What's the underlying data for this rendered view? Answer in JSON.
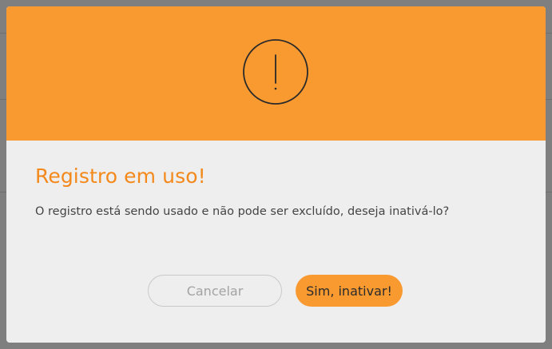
{
  "dialog": {
    "icon": "exclamation-circle-icon",
    "title": "Registro em uso!",
    "message": "O registro está sendo usado e não pode ser excluído, deseja inativá-lo?",
    "cancel_label": "Cancelar",
    "confirm_label": "Sim, inativar!"
  },
  "colors": {
    "accent": "#f99a30",
    "title": "#f4891b",
    "body_bg": "#eeeeee",
    "overlay": "#7f7f7f"
  }
}
